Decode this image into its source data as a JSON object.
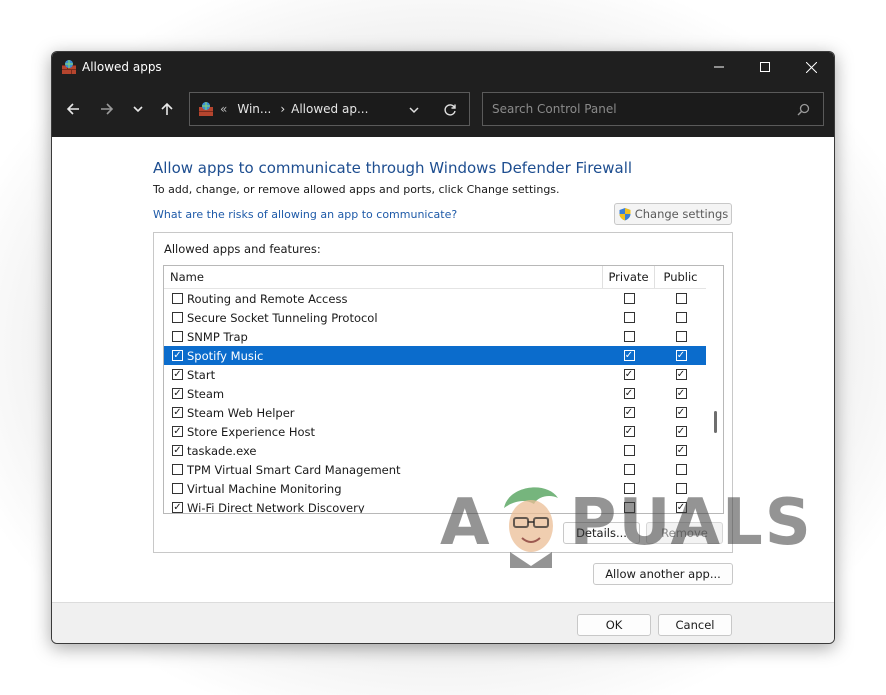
{
  "window": {
    "title": "Allowed apps",
    "controls": {
      "minimize": "—",
      "maximize": "☐",
      "close": "✕"
    }
  },
  "address": {
    "back": "←",
    "forward": "→",
    "history": "⌄",
    "up": "↑",
    "chevrons": "«",
    "crumb_1": "Win...",
    "separator": "›",
    "crumb_2": "Allowed ap...",
    "dropdown": "⌄",
    "refresh": "↻",
    "search_placeholder": "Search Control Panel"
  },
  "main": {
    "heading": "Allow apps to communicate through Windows Defender Firewall",
    "subtext": "To add, change, or remove allowed apps and ports, click Change settings.",
    "risks_link": "What are the risks of allowing an app to communicate?",
    "change_settings": "Change settings",
    "group_title": "Allowed apps and features:",
    "columns": {
      "name": "Name",
      "private": "Private",
      "public": "Public"
    },
    "details_button": "Details...",
    "remove_button": "Remove",
    "allow_another_button": "Allow another app..."
  },
  "apps": [
    {
      "name": "Routing and Remote Access",
      "enabled": false,
      "private": false,
      "public": false
    },
    {
      "name": "Secure Socket Tunneling Protocol",
      "enabled": false,
      "private": false,
      "public": false
    },
    {
      "name": "SNMP Trap",
      "enabled": false,
      "private": false,
      "public": false
    },
    {
      "name": "Spotify Music",
      "enabled": true,
      "private": true,
      "public": true,
      "selected": true
    },
    {
      "name": "Start",
      "enabled": true,
      "private": true,
      "public": true
    },
    {
      "name": "Steam",
      "enabled": true,
      "private": true,
      "public": true
    },
    {
      "name": "Steam Web Helper",
      "enabled": true,
      "private": true,
      "public": true
    },
    {
      "name": "Store Experience Host",
      "enabled": true,
      "private": true,
      "public": true
    },
    {
      "name": "taskade.exe",
      "enabled": true,
      "private": false,
      "public": true
    },
    {
      "name": "TPM Virtual Smart Card Management",
      "enabled": false,
      "private": false,
      "public": false
    },
    {
      "name": "Virtual Machine Monitoring",
      "enabled": false,
      "private": false,
      "public": false
    },
    {
      "name": "Wi-Fi Direct Network Discovery",
      "enabled": true,
      "private": false,
      "public": true
    }
  ],
  "footer": {
    "ok": "OK",
    "cancel": "Cancel"
  },
  "watermark": {
    "left": "A",
    "right": "PUALS"
  },
  "colors": {
    "accent": "#0b6ccc",
    "heading": "#1e4e90",
    "link": "#1e5aa8",
    "titlebar": "#1f1f1f"
  }
}
